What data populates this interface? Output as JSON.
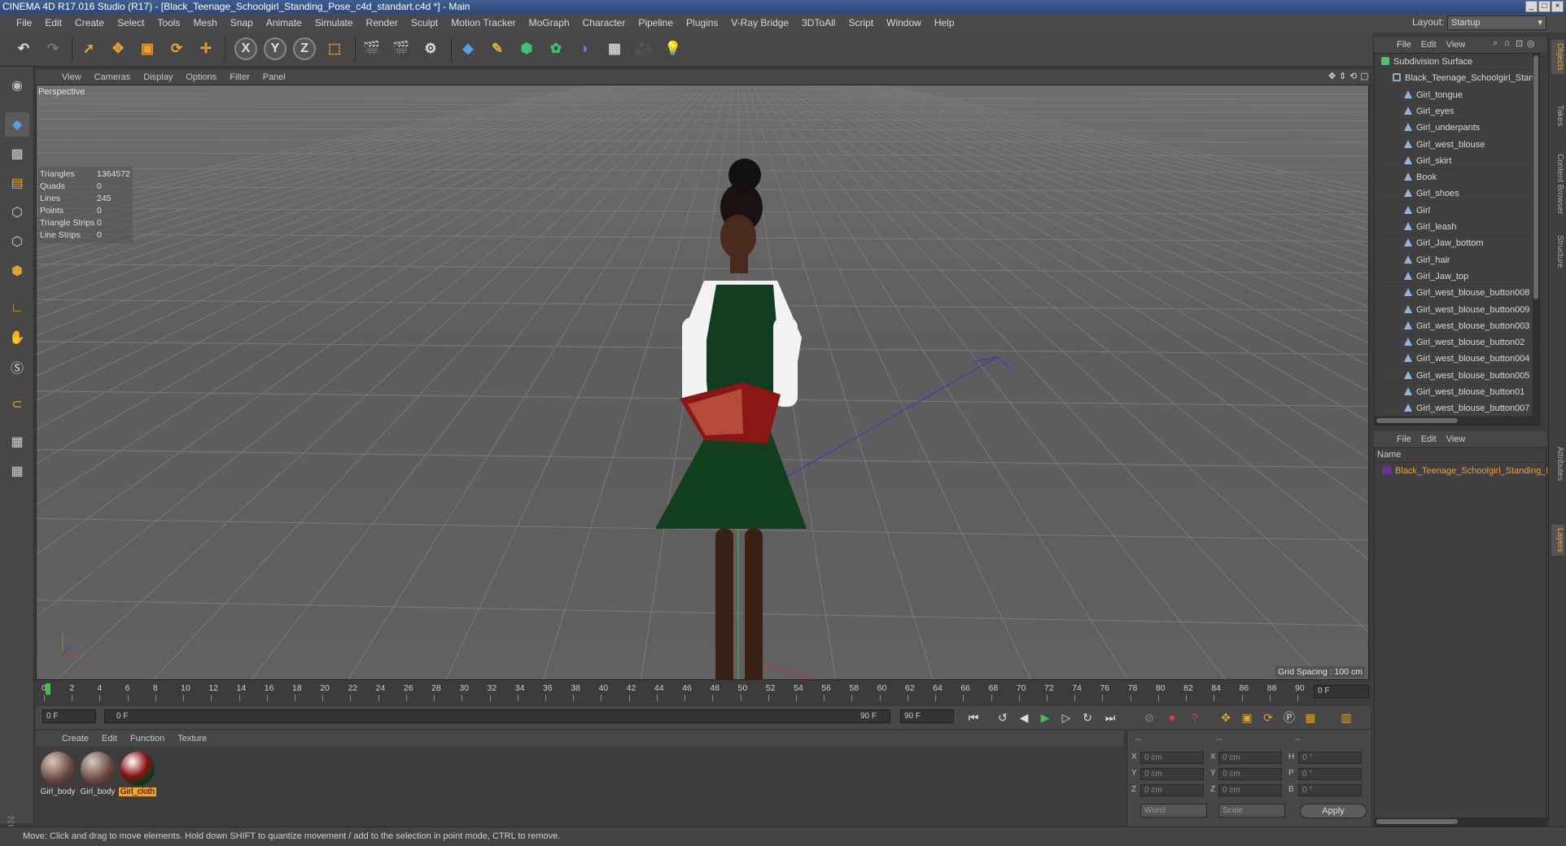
{
  "window": {
    "title": "CINEMA 4D R17.016 Studio (R17) - [Black_Teenage_Schoolgirl_Standing_Pose_c4d_standart.c4d *] - Main"
  },
  "menu": [
    "File",
    "Edit",
    "Create",
    "Select",
    "Tools",
    "Mesh",
    "Snap",
    "Animate",
    "Simulate",
    "Render",
    "Sculpt",
    "Motion Tracker",
    "MoGraph",
    "Character",
    "Pipeline",
    "Plugins",
    "V-Ray Bridge",
    "3DToAll",
    "Script",
    "Window",
    "Help"
  ],
  "layout": {
    "label": "Layout:",
    "value": "Startup"
  },
  "viewport": {
    "menu": [
      "View",
      "Cameras",
      "Display",
      "Options",
      "Filter",
      "Panel"
    ],
    "label": "Perspective",
    "stats": [
      {
        "k": "Triangles",
        "v": "1364572"
      },
      {
        "k": "Quads",
        "v": "0"
      },
      {
        "k": "Lines",
        "v": "245"
      },
      {
        "k": "Points",
        "v": "0"
      },
      {
        "k": "Triangle Strips",
        "v": "0"
      },
      {
        "k": "Line Strips",
        "v": "0"
      }
    ],
    "grid_spacing": "Grid Spacing : 100 cm"
  },
  "timeline": {
    "ticks": [
      "0",
      "2",
      "4",
      "6",
      "8",
      "10",
      "12",
      "14",
      "16",
      "18",
      "20",
      "22",
      "24",
      "26",
      "28",
      "30",
      "32",
      "34",
      "36",
      "38",
      "40",
      "42",
      "44",
      "46",
      "48",
      "50",
      "52",
      "54",
      "56",
      "58",
      "60",
      "62",
      "64",
      "66",
      "68",
      "70",
      "72",
      "74",
      "76",
      "78",
      "80",
      "82",
      "84",
      "86",
      "88",
      "90"
    ],
    "current_frame": "0 F",
    "start": "0 F",
    "range_start": "0 F",
    "range_end": "90 F",
    "end": "90 F"
  },
  "materials": {
    "menu": [
      "Create",
      "Edit",
      "Function",
      "Texture"
    ],
    "items": [
      {
        "label": "Girl_body"
      },
      {
        "label": "Girl_body"
      },
      {
        "label": "Girl_cloth"
      }
    ]
  },
  "coordinates": {
    "pos_x": "0 cm",
    "pos_y": "0 cm",
    "pos_z": "0 cm",
    "size_x": "0 cm",
    "size_y": "0 cm",
    "size_z": "0 cm",
    "rot_h": "0 °",
    "rot_p": "0 °",
    "rot_b": "0 °",
    "mode": "World",
    "scale": "Scale",
    "apply": "Apply",
    "labels": {
      "x": "X",
      "y": "Y",
      "z": "Z",
      "h": "H",
      "p": "P",
      "b": "B"
    },
    "header": [
      "--",
      "--",
      "--"
    ]
  },
  "status": "Move: Click and drag to move elements. Hold down SHIFT to quantize movement / add to the selection in point mode, CTRL to remove.",
  "object_manager": {
    "menu": [
      "File",
      "Edit",
      "View"
    ],
    "objects": [
      {
        "name": "Subdivision Surface",
        "type": "sub",
        "indent": 0
      },
      {
        "name": "Black_Teenage_Schoolgirl_Standing_Pose",
        "type": "null",
        "indent": 1
      },
      {
        "name": "Girl_tongue",
        "type": "poly",
        "indent": 2
      },
      {
        "name": "Girl_eyes",
        "type": "poly",
        "indent": 2
      },
      {
        "name": "Girl_underpants",
        "type": "poly",
        "indent": 2
      },
      {
        "name": "Girl_west_blouse",
        "type": "poly",
        "indent": 2
      },
      {
        "name": "Girl_skirt",
        "type": "poly",
        "indent": 2
      },
      {
        "name": "Book",
        "type": "poly",
        "indent": 2
      },
      {
        "name": "Girl_shoes",
        "type": "poly",
        "indent": 2
      },
      {
        "name": "Girl",
        "type": "poly",
        "indent": 2
      },
      {
        "name": "Girl_leash",
        "type": "poly",
        "indent": 2
      },
      {
        "name": "Girl_Jaw_bottom",
        "type": "poly",
        "indent": 2
      },
      {
        "name": "Girl_hair",
        "type": "poly",
        "indent": 2
      },
      {
        "name": "Girl_Jaw_top",
        "type": "poly",
        "indent": 2
      },
      {
        "name": "Girl_west_blouse_button008",
        "type": "poly",
        "indent": 2
      },
      {
        "name": "Girl_west_blouse_button009",
        "type": "poly",
        "indent": 2
      },
      {
        "name": "Girl_west_blouse_button003",
        "type": "poly",
        "indent": 2
      },
      {
        "name": "Girl_west_blouse_button02",
        "type": "poly",
        "indent": 2
      },
      {
        "name": "Girl_west_blouse_button004",
        "type": "poly",
        "indent": 2
      },
      {
        "name": "Girl_west_blouse_button005",
        "type": "poly",
        "indent": 2
      },
      {
        "name": "Girl_west_blouse_button01",
        "type": "poly",
        "indent": 2
      },
      {
        "name": "Girl_west_blouse_button007",
        "type": "poly",
        "indent": 2
      }
    ]
  },
  "layer_manager": {
    "menu": [
      "File",
      "Edit",
      "View"
    ],
    "column": "Name",
    "row": "Black_Teenage_Schoolgirl_Standing_Pose"
  },
  "right_tabs": [
    "Objects",
    "Takes",
    "Content Browser",
    "Structure",
    "Attributes",
    "Layers"
  ]
}
